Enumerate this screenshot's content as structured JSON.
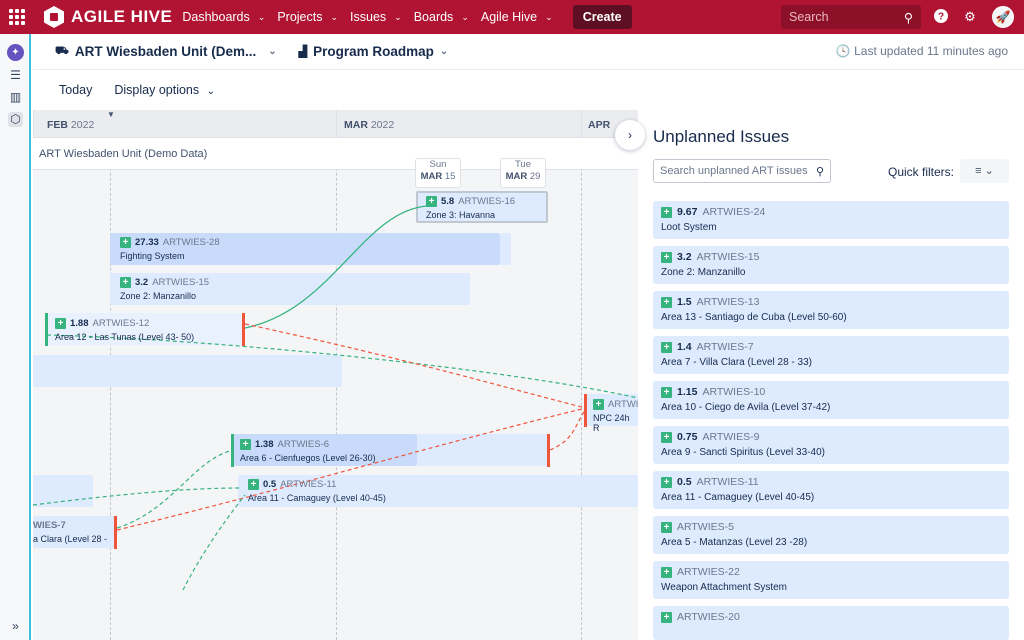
{
  "topbar": {
    "brand": "AGILE HIVE",
    "nav": [
      "Dashboards",
      "Projects",
      "Issues",
      "Boards",
      "Agile Hive"
    ],
    "create_label": "Create",
    "search_placeholder": "Search"
  },
  "header": {
    "unit_title": "ART Wiesbaden Unit (Dem...",
    "roadmap_title": "Program Roadmap",
    "last_updated": "Last updated 11 minutes ago",
    "today_label": "Today",
    "display_options_label": "Display options"
  },
  "timeline": {
    "months": [
      {
        "name": "FEB",
        "year": "2022"
      },
      {
        "name": "MAR",
        "year": "2022"
      },
      {
        "name": "APR",
        "year": ""
      }
    ],
    "lane_title": "ART Wiesbaden Unit (Demo Data)",
    "date_bubbles": [
      {
        "day": "Sun",
        "month": "MAR",
        "date": "15"
      },
      {
        "day": "Tue",
        "month": "MAR",
        "date": "29"
      }
    ],
    "cards": [
      {
        "points": "5.8",
        "key": "ARTWIES-16",
        "name": "Zone 3: Havanna"
      },
      {
        "points": "27.33",
        "key": "ARTWIES-28",
        "name": "Fighting System"
      },
      {
        "points": "3.2",
        "key": "ARTWIES-15",
        "name": "Zone 2: Manzanillo"
      },
      {
        "points": "1.88",
        "key": "ARTWIES-12",
        "name": "Area 12 - Las Tunas (Level 43- 50)"
      },
      {
        "points": "",
        "key": "ARTWI",
        "name": "NPC 24h R"
      },
      {
        "points": "1.38",
        "key": "ARTWIES-6",
        "name": "Area 6 - Cienfuegos (Level 26-30)"
      },
      {
        "points": "0.5",
        "key": "ARTWIES-11",
        "name": "Area 11 - Camaguey (Level 40-45)"
      },
      {
        "points": "",
        "key": "WIES-7",
        "name": "a Clara (Level 28 -"
      }
    ]
  },
  "panel": {
    "title": "Unplanned Issues",
    "search_placeholder": "Search unplanned ART issues",
    "quick_filters_label": "Quick filters:",
    "issues": [
      {
        "points": "9.67",
        "key": "ARTWIES-24",
        "name": "Loot System"
      },
      {
        "points": "3.2",
        "key": "ARTWIES-15",
        "name": "Zone 2: Manzanillo"
      },
      {
        "points": "1.5",
        "key": "ARTWIES-13",
        "name": "Area 13 - Santiago de Cuba (Level 50-60)"
      },
      {
        "points": "1.4",
        "key": "ARTWIES-7",
        "name": "Area 7 - Villa Clara (Level 28 - 33)"
      },
      {
        "points": "1.15",
        "key": "ARTWIES-10",
        "name": "Area 10 - Ciego de Avila (Level 37-42)"
      },
      {
        "points": "0.75",
        "key": "ARTWIES-9",
        "name": "Area 9 - Sancti Spiritus (Level 33-40)"
      },
      {
        "points": "0.5",
        "key": "ARTWIES-11",
        "name": "Area 11 - Camaguey (Level 40-45)"
      },
      {
        "points": "",
        "key": "ARTWIES-5",
        "name": "Area 5 - Matanzas (Level 23 -28)"
      },
      {
        "points": "",
        "key": "ARTWIES-22",
        "name": "Weapon Attachment System"
      },
      {
        "points": "",
        "key": "ARTWIES-20",
        "name": ""
      }
    ]
  },
  "colors": {
    "topbar": "#b01432",
    "bar": "#deebff",
    "green": "#36b37e",
    "red": "#f0553b"
  }
}
